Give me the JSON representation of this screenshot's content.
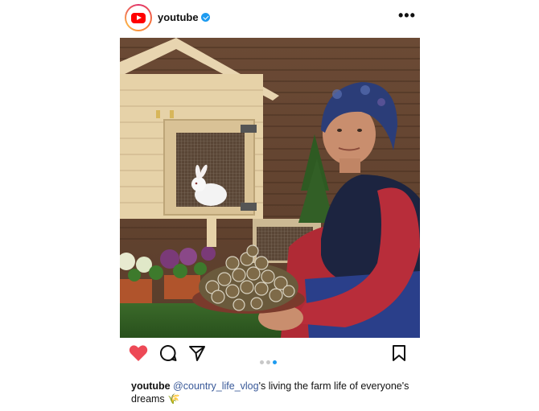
{
  "post": {
    "username": "youtube",
    "more_label": "•••"
  },
  "carousel": {
    "count": 3,
    "active_index": 2
  },
  "caption": {
    "user": "youtube",
    "mention": "@country_life_vlog",
    "text": "'s living the farm life of everyone's dreams",
    "emoji": "🌾"
  },
  "colors": {
    "like_red": "#ed4956",
    "verified_blue": "#1d9bf0",
    "mention_blue": "#385898",
    "youtube_red": "#ff0000"
  },
  "icons": [
    "youtube-logo-icon",
    "verified-icon",
    "more-icon",
    "heart-icon",
    "comment-icon",
    "share-icon",
    "bookmark-icon",
    "wheat-icon"
  ]
}
